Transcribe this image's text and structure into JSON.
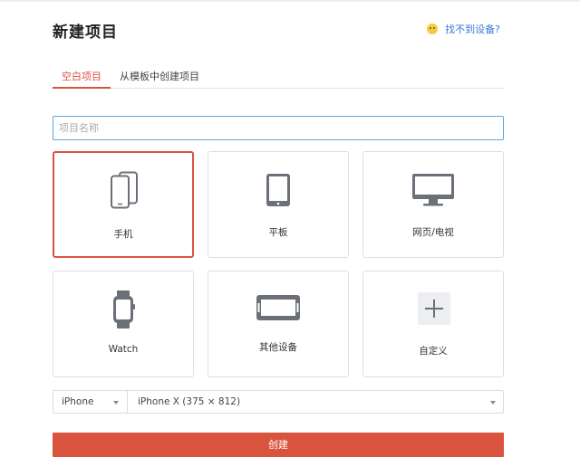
{
  "header": {
    "title": "新建项目",
    "help_label": "找不到设备?"
  },
  "tabs": [
    {
      "label": "空白项目",
      "active": true
    },
    {
      "label": "从模板中创建项目",
      "active": false
    }
  ],
  "name_field": {
    "placeholder": "项目名称",
    "value": ""
  },
  "devices": [
    {
      "label": "手机",
      "icon": "phone-icon",
      "selected": true
    },
    {
      "label": "平板",
      "icon": "tablet-icon",
      "selected": false
    },
    {
      "label": "网页/电视",
      "icon": "monitor-icon",
      "selected": false
    },
    {
      "label": "Watch",
      "icon": "watch-icon",
      "selected": false
    },
    {
      "label": "其他设备",
      "icon": "device-icon",
      "selected": false
    },
    {
      "label": "自定义",
      "icon": "plus-icon",
      "selected": false
    }
  ],
  "device_select": {
    "type": "iPhone",
    "model": "iPhone X (375 × 812)"
  },
  "create_button": {
    "label": "创建"
  },
  "colors": {
    "accent": "#d9543f",
    "link": "#3b7ad9",
    "icon": "#6b6f78"
  }
}
